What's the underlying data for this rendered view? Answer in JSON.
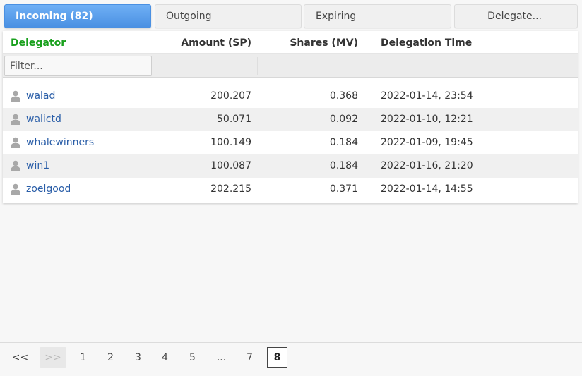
{
  "tabs": [
    {
      "label": "Incoming (82)",
      "active": true
    },
    {
      "label": "Outgoing",
      "active": false
    },
    {
      "label": "Expiring",
      "active": false
    },
    {
      "label": "Delegate...",
      "active": false
    }
  ],
  "table": {
    "headers": {
      "delegator": "Delegator",
      "amount": "Amount (SP)",
      "shares": "Shares (MV)",
      "time": "Delegation Time"
    },
    "filter_placeholder": "Filter...",
    "rows": [
      {
        "delegator": "walad",
        "amount": "200.207",
        "shares": "0.368",
        "time": "2022-01-14, 23:54"
      },
      {
        "delegator": "walictd",
        "amount": "50.071",
        "shares": "0.092",
        "time": "2022-01-10, 12:21"
      },
      {
        "delegator": "whalewinners",
        "amount": "100.149",
        "shares": "0.184",
        "time": "2022-01-09, 19:45"
      },
      {
        "delegator": "win1",
        "amount": "100.087",
        "shares": "0.184",
        "time": "2022-01-16, 21:20"
      },
      {
        "delegator": "zoelgood",
        "amount": "202.215",
        "shares": "0.371",
        "time": "2022-01-14, 14:55"
      }
    ]
  },
  "pagination": {
    "first": "<<",
    "next": ">>",
    "pages": [
      "1",
      "2",
      "3",
      "4",
      "5",
      "...",
      "7",
      "8"
    ],
    "current": "8"
  },
  "colors": {
    "active_tab": "#4a90e2",
    "delegator_header": "#19a01d",
    "username_link": "#2a5ea8"
  },
  "icons": {
    "row_user": "user-icon"
  }
}
